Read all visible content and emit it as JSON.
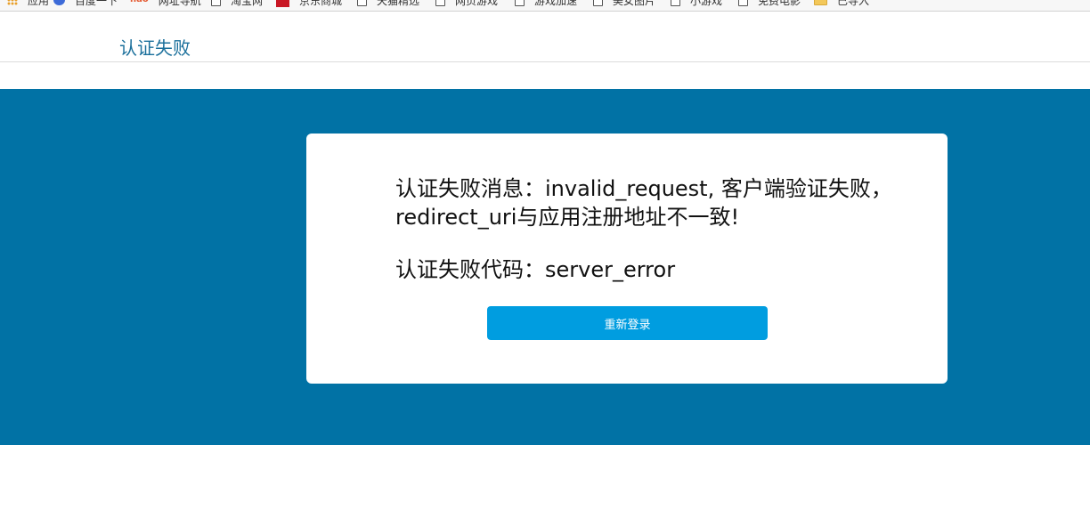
{
  "bookmarks": [
    {
      "label": "应用",
      "icon": "apps-icon"
    },
    {
      "label": "百度一下",
      "icon": "baidu-icon"
    },
    {
      "label": "网址导航",
      "icon": "hao123-icon"
    },
    {
      "label": "淘宝网",
      "icon": "page-icon"
    },
    {
      "label": "京东商城",
      "icon": "jd-icon"
    },
    {
      "label": "天猫精选",
      "icon": "page-icon"
    },
    {
      "label": "网页游戏",
      "icon": "page-icon"
    },
    {
      "label": "游戏加速",
      "icon": "page-icon"
    },
    {
      "label": "美女图片",
      "icon": "page-icon"
    },
    {
      "label": "小游戏",
      "icon": "page-icon"
    },
    {
      "label": "免费电影",
      "icon": "page-icon"
    },
    {
      "label": "已导入",
      "icon": "folder-icon"
    }
  ],
  "header": {
    "title": "认证失败"
  },
  "error": {
    "message": "认证失败消息：invalid_request, 客户端验证失败，redirect_uri与应用注册地址不一致!",
    "code": "认证失败代码：server_error"
  },
  "actions": {
    "relogin_label": "重新登录"
  },
  "colors": {
    "banner": "#0172a5",
    "button": "#009de0",
    "title": "#1a6f9b"
  }
}
